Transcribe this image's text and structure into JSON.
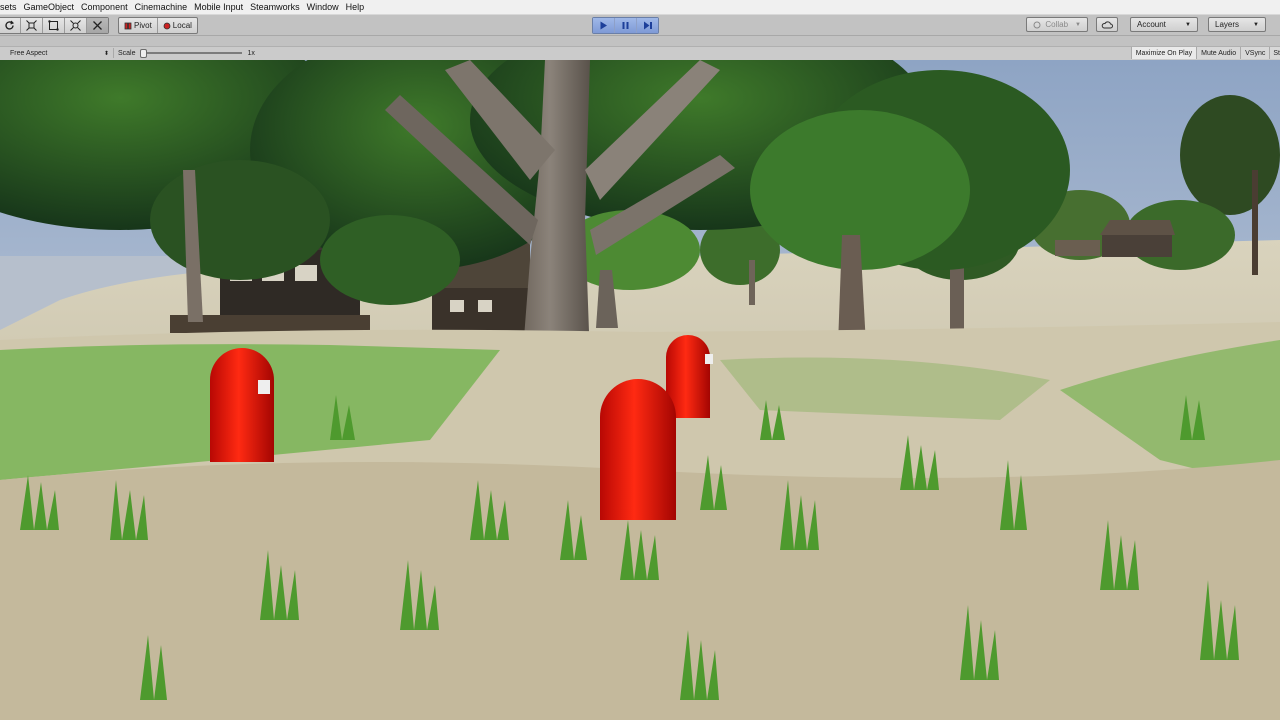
{
  "menu": [
    "sets",
    "GameObject",
    "Component",
    "Cinemachine",
    "Mobile Input",
    "Steamworks",
    "Window",
    "Help"
  ],
  "toolbar": {
    "pivot_label": "Pivot",
    "local_label": "Local",
    "collab_label": "Collab",
    "account_label": "Account",
    "layers_label": "Layers"
  },
  "gamebar": {
    "aspect_label": "Free Aspect",
    "scale_label": "Scale",
    "scale_value": "1x",
    "maximize_label": "Maximize On Play",
    "mute_label": "Mute Audio",
    "vsync_label": "VSync",
    "stats_label": "St"
  },
  "scene": {
    "colors": {
      "sky": "#aebfd6",
      "grass": "#5aa83a",
      "sand": "#d9d2bb",
      "capsule": "#e0100a"
    }
  }
}
